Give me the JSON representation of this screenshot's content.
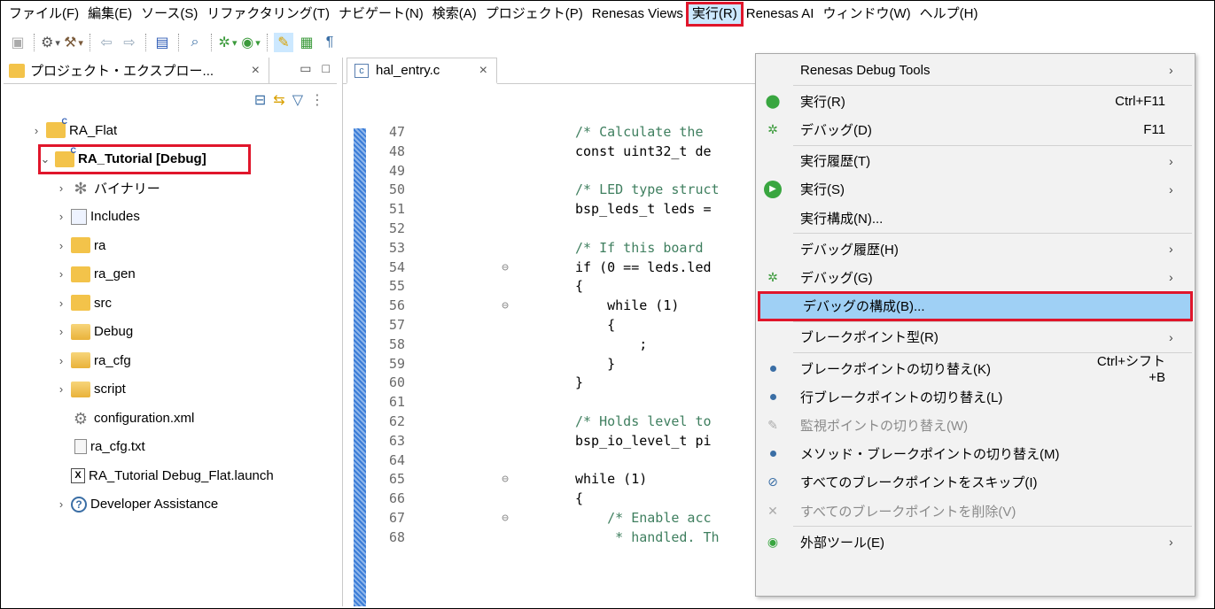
{
  "menubar": {
    "items": [
      {
        "label": "ファイル(F)"
      },
      {
        "label": "編集(E)"
      },
      {
        "label": "ソース(S)"
      },
      {
        "label": "リファクタリング(T)"
      },
      {
        "label": "ナビゲート(N)"
      },
      {
        "label": "検索(A)"
      },
      {
        "label": "プロジェクト(P)"
      },
      {
        "label": "Renesas Views"
      },
      {
        "label": "実行(R)",
        "active": true
      },
      {
        "label": "Renesas AI"
      },
      {
        "label": "ウィンドウ(W)"
      },
      {
        "label": "ヘルプ(H)"
      }
    ]
  },
  "explorer": {
    "tab_label": "プロジェクト・エクスプロー...",
    "tree": [
      {
        "label": "RA_Flat",
        "level": 0,
        "icon": "project-folder-icon"
      },
      {
        "label": "RA_Tutorial [Debug]",
        "level": 0,
        "icon": "project-folder-icon",
        "selected": true
      },
      {
        "label": "バイナリー",
        "level": 1,
        "icon": "binaries-icon"
      },
      {
        "label": "Includes",
        "level": 1,
        "icon": "includes-icon"
      },
      {
        "label": "ra",
        "level": 1,
        "icon": "source-folder-icon"
      },
      {
        "label": "ra_gen",
        "level": 1,
        "icon": "source-folder-icon"
      },
      {
        "label": "src",
        "level": 1,
        "icon": "source-folder-icon"
      },
      {
        "label": "Debug",
        "level": 1,
        "icon": "folder-icon"
      },
      {
        "label": "ra_cfg",
        "level": 1,
        "icon": "folder-icon"
      },
      {
        "label": "script",
        "level": 1,
        "icon": "folder-icon"
      },
      {
        "label": "configuration.xml",
        "level": 1,
        "icon": "config-gear-icon"
      },
      {
        "label": "ra_cfg.txt",
        "level": 1,
        "icon": "text-file-icon"
      },
      {
        "label": "RA_Tutorial Debug_Flat.launch",
        "level": 1,
        "icon": "launch-file-icon"
      },
      {
        "label": "Developer Assistance",
        "level": 1,
        "icon": "help-icon"
      }
    ]
  },
  "editor": {
    "tab_label": "hal_entry.c",
    "lines": [
      {
        "n": "47",
        "code": "/* Calculate the ",
        "type": "comment"
      },
      {
        "n": "48",
        "code": "const uint32_t de",
        "type": "code"
      },
      {
        "n": "49",
        "code": "",
        "type": "code"
      },
      {
        "n": "50",
        "code": "/* LED type struct",
        "type": "comment"
      },
      {
        "n": "51",
        "code": "bsp_leds_t leds = ",
        "type": "code"
      },
      {
        "n": "52",
        "code": "",
        "type": "code"
      },
      {
        "n": "53",
        "code": "/* If this board ",
        "type": "comment"
      },
      {
        "n": "54",
        "code": "if (0 == leds.led",
        "type": "code",
        "fold": true
      },
      {
        "n": "55",
        "code": "{",
        "type": "code"
      },
      {
        "n": "56",
        "code": "    while (1)",
        "type": "code",
        "fold": true
      },
      {
        "n": "57",
        "code": "    {",
        "type": "code"
      },
      {
        "n": "58",
        "code": "        ;",
        "type": "code"
      },
      {
        "n": "59",
        "code": "    }",
        "type": "code"
      },
      {
        "n": "60",
        "code": "}",
        "type": "code"
      },
      {
        "n": "61",
        "code": "",
        "type": "code"
      },
      {
        "n": "62",
        "code": "/* Holds level to ",
        "type": "comment"
      },
      {
        "n": "63",
        "code": "bsp_io_level_t pi",
        "type": "code"
      },
      {
        "n": "64",
        "code": "",
        "type": "code"
      },
      {
        "n": "65",
        "code": "while (1)",
        "type": "code",
        "fold": true
      },
      {
        "n": "66",
        "code": "{",
        "type": "code"
      },
      {
        "n": "67",
        "code": "    /* Enable acc",
        "type": "comment",
        "fold": true
      },
      {
        "n": "68",
        "code": "     * handled. Th",
        "type": "comment"
      }
    ]
  },
  "run_menu": {
    "items": [
      {
        "label": "Renesas Debug Tools",
        "shortcut": "",
        "submenu": true,
        "icon": ""
      },
      {
        "sep": true
      },
      {
        "label": "実行(R)",
        "shortcut": "Ctrl+F11",
        "submenu": false,
        "icon": "run-icon"
      },
      {
        "label": "デバッグ(D)",
        "shortcut": "F11",
        "submenu": false,
        "icon": "debug-bug-icon"
      },
      {
        "sep": true
      },
      {
        "label": "実行履歴(T)",
        "shortcut": "",
        "submenu": true,
        "icon": ""
      },
      {
        "label": "実行(S)",
        "shortcut": "",
        "submenu": true,
        "icon": "run-as-icon"
      },
      {
        "label": "実行構成(N)...",
        "shortcut": "",
        "submenu": false,
        "icon": ""
      },
      {
        "sep": true
      },
      {
        "label": "デバッグ履歴(H)",
        "shortcut": "",
        "submenu": true,
        "icon": ""
      },
      {
        "label": "デバッグ(G)",
        "shortcut": "",
        "submenu": true,
        "icon": "debug-as-icon"
      },
      {
        "label": "デバッグの構成(B)...",
        "shortcut": "",
        "submenu": false,
        "icon": "",
        "highlighted": true
      },
      {
        "sep": true
      },
      {
        "label": "ブレークポイント型(R)",
        "shortcut": "",
        "submenu": true,
        "icon": ""
      },
      {
        "sep": true
      },
      {
        "label": "ブレークポイントの切り替え(K)",
        "shortcut": "Ctrl+シフト+B",
        "submenu": false,
        "icon": "breakpoint-dot-icon"
      },
      {
        "label": "行ブレークポイントの切り替え(L)",
        "shortcut": "",
        "submenu": false,
        "icon": "breakpoint-dot-icon"
      },
      {
        "label": "監視ポイントの切り替え(W)",
        "shortcut": "",
        "submenu": false,
        "icon": "watchpoint-icon",
        "disabled": true
      },
      {
        "label": "メソッド・ブレークポイントの切り替え(M)",
        "shortcut": "",
        "submenu": false,
        "icon": "breakpoint-dot-icon"
      },
      {
        "label": "すべてのブレークポイントをスキップ(I)",
        "shortcut": "",
        "submenu": false,
        "icon": "skip-breakpoints-icon"
      },
      {
        "label": "すべてのブレークポイントを削除(V)",
        "shortcut": "",
        "submenu": false,
        "icon": "remove-breakpoints-icon",
        "disabled": true
      },
      {
        "sep": true
      },
      {
        "label": "外部ツール(E)",
        "shortcut": "",
        "submenu": true,
        "icon": "external-tools-icon"
      }
    ]
  },
  "colors": {
    "highlight_box": "#e0162b",
    "menu_selection": "#9fd0f5"
  }
}
